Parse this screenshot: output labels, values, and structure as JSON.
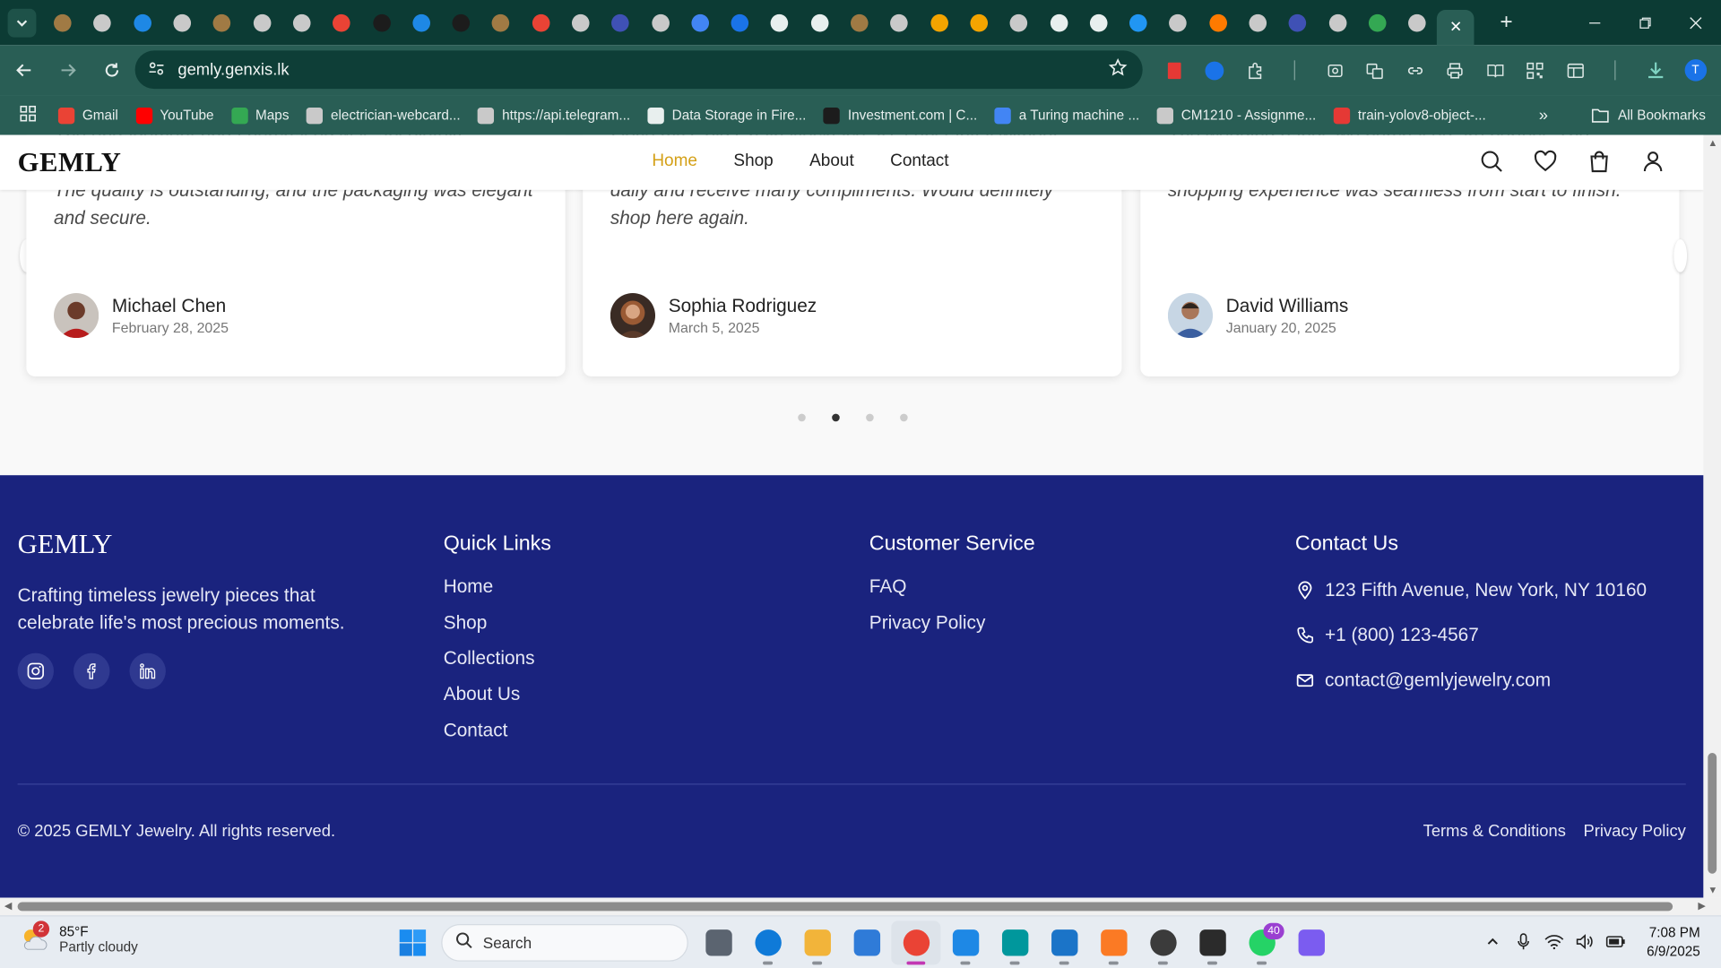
{
  "browser": {
    "url": "gemly.genxis.lk",
    "active_tab_close": "✕",
    "new_tab": "+",
    "profile_initial": "T",
    "tab_favicon_colors": [
      "#a07a44",
      "#c9c9c9",
      "#1e88e5",
      "#c9c9c9",
      "#a07a44",
      "#c9c9c9",
      "#c9c9c9",
      "#ea4335",
      "#1c1c1c",
      "#1e88e5",
      "#1c1c1c",
      "#a07a44",
      "#ea4335",
      "#c9c9c9",
      "#3f51b5",
      "#c9c9c9",
      "#4285f4",
      "#1a73e8",
      "#e8efee",
      "#e8efee",
      "#a07a44",
      "#c9c9c9",
      "#f4a400",
      "#f4a400",
      "#c9c9c9",
      "#e8efee",
      "#e8efee",
      "#2196f3",
      "#c9c9c9",
      "#ff7a00",
      "#c9c9c9",
      "#3f51b5",
      "#c9c9c9",
      "#34a853",
      "#c9c9c9"
    ],
    "bookmarks": [
      {
        "label": "Gmail",
        "color": "#ea4335"
      },
      {
        "label": "YouTube",
        "color": "#ff0000"
      },
      {
        "label": "Maps",
        "color": "#34a853"
      },
      {
        "label": "electrician-webcard...",
        "color": "#c9c9c9"
      },
      {
        "label": "https://api.telegram...",
        "color": "#c9c9c9"
      },
      {
        "label": "Data Storage in Fire...",
        "color": "#e8efee"
      },
      {
        "label": "Investment.com | C...",
        "color": "#1c1c1c"
      },
      {
        "label": "a Turing machine ...",
        "color": "#4285f4"
      },
      {
        "label": "CM1210 - Assignme...",
        "color": "#c9c9c9"
      },
      {
        "label": "train-yolov8-object-...",
        "color": "#e53935"
      }
    ],
    "bookmarks_more": "»",
    "all_bookmarks": "All Bookmarks"
  },
  "site": {
    "logo": "GEMLY",
    "nav": [
      {
        "label": "Home",
        "active": true
      },
      {
        "label": "Shop",
        "active": false
      },
      {
        "label": "About",
        "active": false
      },
      {
        "label": "Contact",
        "active": false
      }
    ],
    "accent_color": "#d4a017",
    "footer_color": "#1a237e"
  },
  "testimonials": [
    {
      "quote": "The engagement ring I purchased was absolutely stunning. My fiancée was speechless when I proposed. The quality is outstanding, and the packaging was elegant and secure.",
      "name": "Michael Chen",
      "date": "February 28, 2025",
      "avatar_color": "#6b3b2a"
    },
    {
      "quote": "I love my Gold Chain Necklace. It's substantial without being too heavy, and the clasp is secure. I wear it almost daily and receive many compliments. Would definitely shop here again.",
      "name": "Sophia Rodriguez",
      "date": "March 5, 2025",
      "avatar_color": "#8a5a3a"
    },
    {
      "quote": "The wedding bands we purchased are perfect. The comfort fit is noticeable, and the quality is exceptional. The shopping experience was seamless from start to finish.",
      "name": "David Williams",
      "date": "January 20, 2025",
      "avatar_color": "#5a4636"
    }
  ],
  "carousel": {
    "pages": 4,
    "current": 2
  },
  "footer": {
    "logo": "GEMLY",
    "tagline": "Crafting timeless jewelry pieces that celebrate life's most precious moments.",
    "social": [
      "instagram-icon",
      "facebook-icon",
      "linkedin-icon"
    ],
    "quick_links": {
      "title": "Quick Links",
      "items": [
        "Home",
        "Shop",
        "Collections",
        "About Us",
        "Contact"
      ]
    },
    "customer_service": {
      "title": "Customer Service",
      "items": [
        "FAQ",
        "Privacy Policy"
      ]
    },
    "contact": {
      "title": "Contact Us",
      "address": "123 Fifth Avenue, New York, NY 10160",
      "phone": "+1 (800) 123-4567",
      "email": "contact@gemlyjewelry.com"
    },
    "copyright": "© 2025 GEMLY Jewelry. All rights reserved.",
    "terms": "Terms & Conditions",
    "privacy": "Privacy Policy"
  },
  "taskbar": {
    "weather_temp": "85°F",
    "weather_desc": "Partly cloudy",
    "weather_badge": "2",
    "search_placeholder": "Search",
    "apps": [
      {
        "name": "task-view",
        "color": "#5b6470"
      },
      {
        "name": "edge",
        "color": "#0f7ad8"
      },
      {
        "name": "file-explorer",
        "color": "#f2b43a"
      },
      {
        "name": "microsoft-store",
        "color": "#2f7bd8"
      },
      {
        "name": "chrome",
        "color": "#ea4335"
      },
      {
        "name": "notepad",
        "color": "#1e88e5"
      },
      {
        "name": "arduino",
        "color": "#00979c"
      },
      {
        "name": "vscode",
        "color": "#1b74c8"
      },
      {
        "name": "xampp",
        "color": "#fb7a24"
      },
      {
        "name": "obs",
        "color": "#3b3b3b"
      },
      {
        "name": "terminal",
        "color": "#2b2b2b"
      },
      {
        "name": "whatsapp",
        "color": "#25d366"
      },
      {
        "name": "app-purple",
        "color": "#7b5cf0"
      }
    ],
    "whatsapp_badge": "40",
    "time": "7:08 PM",
    "date": "6/9/2025"
  }
}
